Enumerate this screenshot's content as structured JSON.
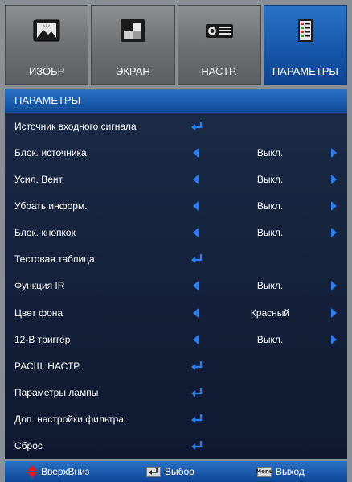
{
  "tabs": [
    {
      "label": "ИЗОБР",
      "icon": "image-icon",
      "active": false
    },
    {
      "label": "ЭКРАН",
      "icon": "screen-icon",
      "active": false
    },
    {
      "label": "НАСТР.",
      "icon": "projector-icon",
      "active": false
    },
    {
      "label": "ПАРАМЕТРЫ",
      "icon": "options-icon",
      "active": true
    }
  ],
  "header": {
    "title": "ПАРАМЕТРЫ"
  },
  "menu": {
    "items": [
      {
        "label": "Источник входного сигнала",
        "type": "enter"
      },
      {
        "label": "Блок. источника.",
        "type": "select",
        "value": "Выкл."
      },
      {
        "label": "Усил. Вент.",
        "type": "select",
        "value": "Выкл."
      },
      {
        "label": "Убрать информ.",
        "type": "select",
        "value": "Выкл."
      },
      {
        "label": "Блок. кнопкок",
        "type": "select",
        "value": "Выкл."
      },
      {
        "label": "Тестовая таблица",
        "type": "enter"
      },
      {
        "label": "Функция IR",
        "type": "select",
        "value": "Выкл."
      },
      {
        "label": "Цвет фона",
        "type": "select",
        "value": "Красный"
      },
      {
        "label": "12-В триггер",
        "type": "select",
        "value": "Выкл."
      },
      {
        "label": "РАСШ. НАСТР.",
        "type": "enter"
      },
      {
        "label": "Параметры лампы",
        "type": "enter"
      },
      {
        "label": "Доп. настройки фильтра",
        "type": "enter"
      },
      {
        "label": "Сброс",
        "type": "enter"
      }
    ]
  },
  "footer": {
    "nav_label": "ВверхВниз",
    "enter_label": "Выбор",
    "menu_key": "Menu",
    "menu_label": "Выход"
  },
  "colors": {
    "accent": "#1555a8",
    "arrow": "#2b7ff0",
    "nav_arrow": "#e21b1b"
  }
}
